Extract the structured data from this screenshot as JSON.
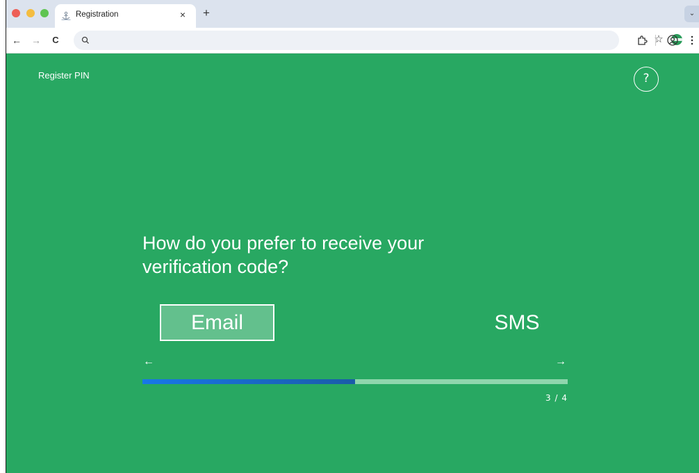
{
  "browser": {
    "tab": {
      "title": "Registration",
      "close_glyph": "×",
      "favicon": "anchor-icon"
    },
    "new_tab_glyph": "+",
    "tab_search_glyph": "⌄",
    "nav": {
      "back": "←",
      "forward": "→",
      "reload": "C"
    },
    "omnibox": {
      "value": "",
      "placeholder": ""
    },
    "bookmark_glyph": "☆"
  },
  "page": {
    "title": "Register PIN",
    "help_label": "?",
    "question_line1": "How do you prefer to receive your",
    "question_line2": "verification code?",
    "options": [
      {
        "label": "Email",
        "selected": true
      },
      {
        "label": "SMS",
        "selected": false
      }
    ],
    "prev_arrow": "←",
    "next_arrow": "→",
    "progress": {
      "current": 3,
      "total": 4,
      "fill_fraction": 0.5,
      "label": "3 / 4"
    }
  },
  "colors": {
    "page_bg": "#28a862",
    "progress_fill": "#1a6ed0",
    "progress_track": "#8fd6ad",
    "text": "#ffffff"
  }
}
